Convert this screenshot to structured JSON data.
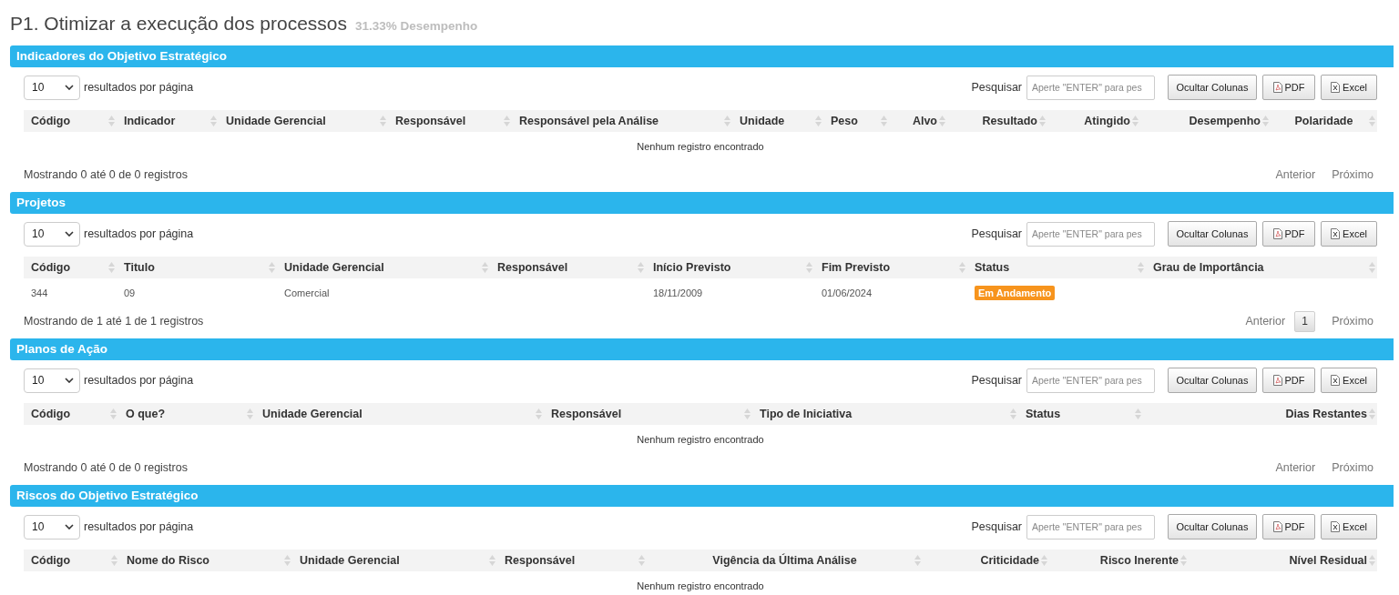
{
  "page": {
    "title": "P1. Otimizar a execução dos processos",
    "performance": "31.33% Desempenho"
  },
  "sections": [
    {
      "title": "Indicadores do Objetivo Estratégico",
      "page_size": "10",
      "page_size_label": "resultados por página",
      "search": {
        "label": "Pesquisar",
        "placeholder": "Aperte \"ENTER\" para pes"
      },
      "buttons": [
        {
          "kind": "columns",
          "label": "Ocultar Colunas"
        },
        {
          "kind": "pdf",
          "label": "PDF"
        },
        {
          "kind": "excel",
          "label": "Excel"
        }
      ],
      "columns": [
        "Código",
        "Indicador",
        "Unidade Gerencial",
        "Responsável",
        "Responsável pela Análise",
        "Unidade",
        "Peso",
        "Alvo",
        "Resultado",
        "Atingido",
        "Desempenho",
        "Polaridade"
      ],
      "empty_message": "Nenhum registro encontrado",
      "info": "Mostrando 0 até 0 de 0 registros",
      "pagination": {
        "previous": "Anterior",
        "next": "Próximo"
      }
    },
    {
      "title": "Projetos",
      "page_size": "10",
      "page_size_label": "resultados por página",
      "search": {
        "label": "Pesquisar",
        "placeholder": "Aperte \"ENTER\" para pes"
      },
      "buttons": [
        {
          "kind": "columns",
          "label": "Ocultar Colunas"
        },
        {
          "kind": "pdf",
          "label": "PDF"
        },
        {
          "kind": "excel",
          "label": "Excel"
        }
      ],
      "columns": [
        "Código",
        "Titulo",
        "Unidade Gerencial",
        "Responsável",
        "Início Previsto",
        "Fim Previsto",
        "Status",
        "Grau de Importância"
      ],
      "rows": [
        {
          "cells": [
            {
              "kind": "text",
              "text": "344"
            },
            {
              "kind": "text",
              "text": "09"
            },
            {
              "kind": "text",
              "text": "Comercial"
            },
            {
              "kind": "blank"
            },
            {
              "kind": "text",
              "text": "18/11/2009"
            },
            {
              "kind": "text",
              "text": "01/06/2024"
            },
            {
              "kind": "badge",
              "text": "Em Andamento",
              "color": "#f7941d"
            },
            {
              "kind": "blank"
            }
          ]
        }
      ],
      "info": "Mostrando de 1 até 1 de 1 registros",
      "pagination": {
        "previous": "Anterior",
        "pages": [
          {
            "label": "1",
            "selected": true
          }
        ],
        "next": "Próximo"
      }
    },
    {
      "title": "Planos de Ação",
      "page_size": "10",
      "page_size_label": "resultados por página",
      "search": {
        "label": "Pesquisar",
        "placeholder": "Aperte \"ENTER\" para pes"
      },
      "buttons": [
        {
          "kind": "columns",
          "label": "Ocultar Colunas"
        },
        {
          "kind": "pdf",
          "label": "PDF"
        },
        {
          "kind": "excel",
          "label": "Excel"
        }
      ],
      "columns": [
        "Código",
        "O que?",
        "Unidade Gerencial",
        "Responsável",
        "Tipo de Iniciativa",
        "Status",
        "Dias Restantes"
      ],
      "empty_message": "Nenhum registro encontrado",
      "info": "Mostrando 0 até 0 de 0 registros",
      "pagination": {
        "previous": "Anterior",
        "next": "Próximo"
      }
    },
    {
      "title": "Riscos do Objetivo Estratégico",
      "page_size": "10",
      "page_size_label": "resultados por página",
      "search": {
        "label": "Pesquisar",
        "placeholder": "Aperte \"ENTER\" para pes"
      },
      "buttons": [
        {
          "kind": "columns",
          "label": "Ocultar Colunas"
        },
        {
          "kind": "pdf",
          "label": "PDF"
        },
        {
          "kind": "excel",
          "label": "Excel"
        }
      ],
      "columns": [
        "Código",
        "Nome do Risco",
        "Unidade Gerencial",
        "Responsável",
        "Vigência da Última Análise",
        "Criticidade",
        "Risco Inerente",
        "Nível Residual"
      ],
      "empty_message": "Nenhum registro encontrado"
    }
  ]
}
